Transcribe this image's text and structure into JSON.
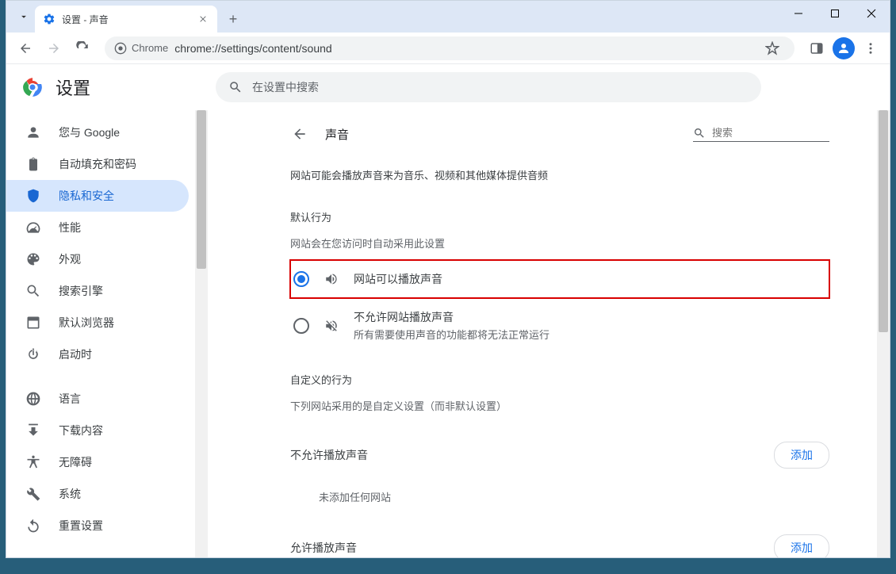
{
  "window": {
    "tab_title": "设置 - 声音"
  },
  "toolbar": {
    "address_prefix": "Chrome",
    "url": "chrome://settings/content/sound"
  },
  "header": {
    "title": "设置",
    "search_placeholder": "在设置中搜索"
  },
  "sidebar": {
    "items": [
      {
        "label": "您与 Google",
        "icon": "person"
      },
      {
        "label": "自动填充和密码",
        "icon": "clipboard"
      },
      {
        "label": "隐私和安全",
        "icon": "shield",
        "active": true
      },
      {
        "label": "性能",
        "icon": "speedometer"
      },
      {
        "label": "外观",
        "icon": "palette"
      },
      {
        "label": "搜索引擎",
        "icon": "search"
      },
      {
        "label": "默认浏览器",
        "icon": "browser"
      },
      {
        "label": "启动时",
        "icon": "power"
      }
    ],
    "items2": [
      {
        "label": "语言",
        "icon": "globe"
      },
      {
        "label": "下载内容",
        "icon": "download"
      },
      {
        "label": "无障碍",
        "icon": "accessibility"
      },
      {
        "label": "系统",
        "icon": "wrench"
      },
      {
        "label": "重置设置",
        "icon": "reset"
      }
    ]
  },
  "page": {
    "title": "声音",
    "search_placeholder": "搜索",
    "description": "网站可能会播放声音来为音乐、视频和其他媒体提供音频",
    "default_behavior_label": "默认行为",
    "default_behavior_sub": "网站会在您访问时自动采用此设置",
    "radio_allow": "网站可以播放声音",
    "radio_block": "不允许网站播放声音",
    "radio_block_sub": "所有需要使用声音的功能都将无法正常运行",
    "custom_label": "自定义的行为",
    "custom_sub": "下列网站采用的是自定义设置（而非默认设置）",
    "block_section": "不允许播放声音",
    "block_empty": "未添加任何网站",
    "allow_section": "允许播放声音",
    "add_button": "添加"
  }
}
